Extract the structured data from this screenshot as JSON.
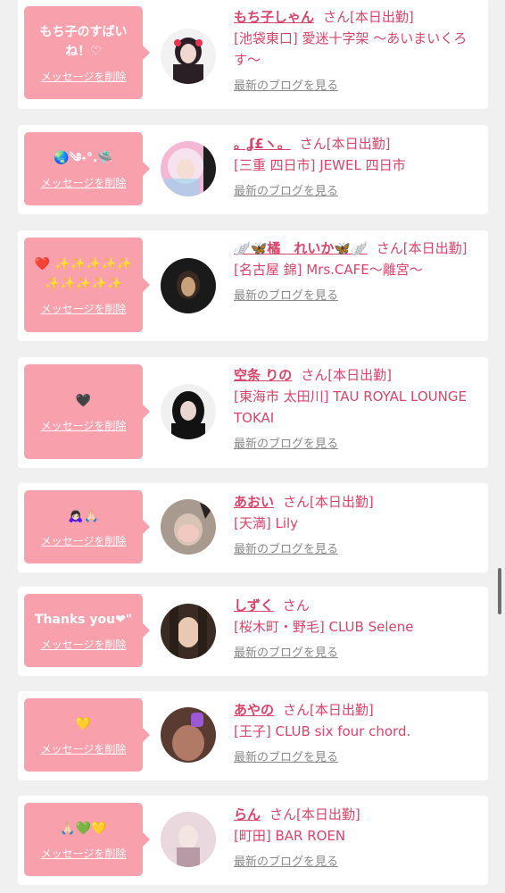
{
  "cards": [
    {
      "message": "もち子のすばいね！♡",
      "delete_label": "メッセージを削除",
      "name": "もち子しゃん",
      "suffix": "さん[本日出勤]",
      "shop": "[池袋東口] 愛迷十字架 〜あいまいくろす〜",
      "blog": "最新のブログを見る",
      "avatar_color": "#2a1f24",
      "avatar_accent": "#e8344f"
    },
    {
      "message": "🌏༄˖°.🛸",
      "delete_label": "メッセージを削除",
      "name": "。ʆ£ヽ。",
      "suffix": "さん[本日出勤]",
      "shop": "[三重 四日市] JEWEL 四日市",
      "blog": "最新のブログを見る",
      "avatar_color": "#f4b8d4",
      "avatar_accent": "#8fd4f0"
    },
    {
      "message": "❤️ ✨✨✨✨✨✨✨✨✨✨",
      "delete_label": "メッセージを削除",
      "name": "🪽🦋橘　れいか🦋🪽",
      "suffix": "さん[本日出勤]",
      "shop": "[名古屋 錦] Mrs.CAFE〜離宮〜",
      "blog": "最新のブログを見る",
      "avatar_color": "#1a1a1a",
      "avatar_accent": "#c9a27d"
    },
    {
      "message": "🖤",
      "delete_label": "メッセージを削除",
      "name": "空条 りの",
      "suffix": "さん[本日出勤]",
      "shop": "[東海市 太田川] TAU ROYAL LOUNGE TOKAI",
      "blog": "最新のブログを見る",
      "avatar_color": "#121212",
      "avatar_accent": "#e8d6cf"
    },
    {
      "message": "🙇🏻‍♀️🙏🏻",
      "delete_label": "メッセージを削除",
      "name": "あおい",
      "suffix": "さん[本日出勤]",
      "shop": "[天満] Lily",
      "blog": "最新のブログを見る",
      "avatar_color": "#a89a8e",
      "avatar_accent": "#f2c9c0"
    },
    {
      "message": "Thanks you❤\"",
      "delete_label": "メッセージを削除",
      "name": "しずく",
      "suffix": "さん",
      "shop": "[桜木町・野毛] CLUB Selene",
      "blog": "最新のブログを見る",
      "avatar_color": "#3a2c25",
      "avatar_accent": "#e9c9b3"
    },
    {
      "message": "💛",
      "delete_label": "メッセージを削除",
      "name": "あやの",
      "suffix": "さん[本日出勤]",
      "shop": "[王子] CLUB six four chord.",
      "blog": "最新のブログを見る",
      "avatar_color": "#5a3b32",
      "avatar_accent": "#9b59d6"
    },
    {
      "message": "🙏🏻💚💛",
      "delete_label": "メッセージを削除",
      "name": "らん",
      "suffix": "さん[本日出勤]",
      "shop": "[町田] BAR ROEN",
      "blog": "最新のブログを見る",
      "avatar_color": "#e9d8de",
      "avatar_accent": "#b89aa6"
    }
  ]
}
